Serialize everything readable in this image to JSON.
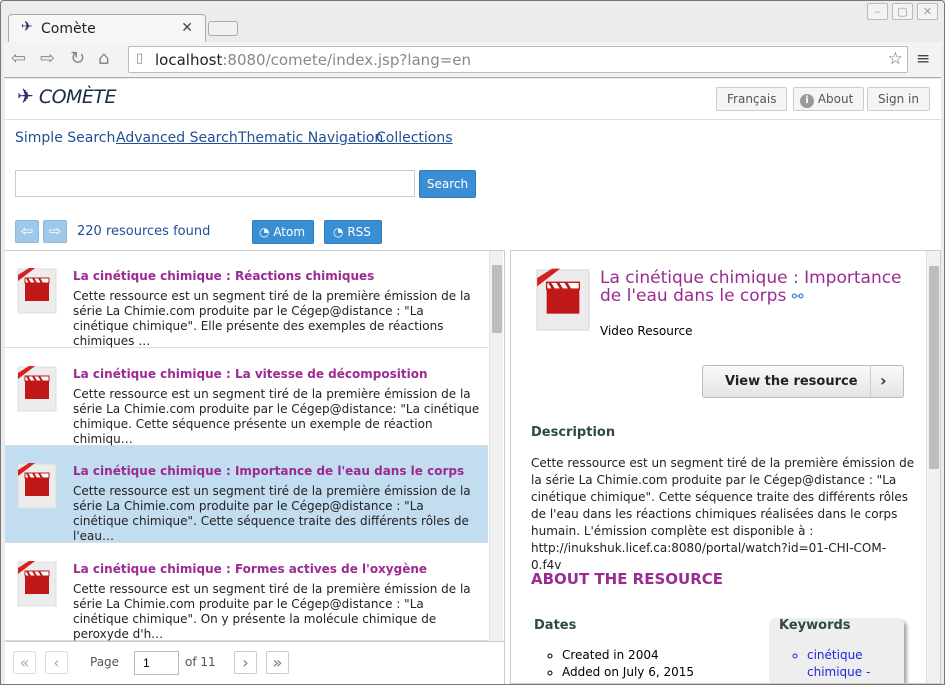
{
  "browser": {
    "tab_title": "Comète",
    "url_host": "localhost",
    "url_rest": ":8080/comete/index.jsp?lang=en"
  },
  "header": {
    "logo": "COMÈTE",
    "lang_button": "Français",
    "about_button": "About",
    "signin_button": "Sign in"
  },
  "nav": [
    "Simple Search",
    "Advanced Search",
    "Thematic Navigation",
    "Collections"
  ],
  "search": {
    "value": "",
    "placeholder": "",
    "button": "Search"
  },
  "results": {
    "count_text": "220 resources found",
    "atom": "Atom",
    "rss": "RSS"
  },
  "list": [
    {
      "title": "La cinétique chimique : Réactions chimiques",
      "desc": "Cette ressource est un segment tiré de la première émission de la série La Chimie.com produite par le Cégep@distance : \"La cinétique chimique\". Elle présente des exemples de réactions chimiques …",
      "selected": false
    },
    {
      "title": "La cinétique chimique : La vitesse de décomposition",
      "desc": "Cette ressource est un segment tiré de la première émission de la série La Chimie.com produite par le Cégep@distance: \"La cinétique chimique. Cette séquence présente un exemple de réaction chimiqu…",
      "selected": false
    },
    {
      "title": "La cinétique chimique : Importance de l'eau dans le corps",
      "desc": "Cette ressource est un segment tiré de la première émission de la série La Chimie.com produite par le Cégep@distance : \"La cinétique chimique\". Cette séquence traite des différents rôles de l'eau…",
      "selected": true
    },
    {
      "title": "La cinétique chimique : Formes actives de l'oxygène",
      "desc": "Cette ressource est un segment tiré de la première émission de la série La Chimie.com produite par le Cégep@distance : \"La cinétique chimique\". On y présente la molécule chimique de peroxyde d'h…",
      "selected": false
    }
  ],
  "pager": {
    "page_label": "Page",
    "page_value": "1",
    "of_label": "of 11"
  },
  "detail": {
    "title": "La cinétique chimique : Importance de l'eau dans le corps",
    "type": "Video Resource",
    "view_button": "View the resource",
    "description_heading": "Description",
    "description": "Cette ressource est un segment tiré de la première émission de la série La Chimie.com produite par le Cégep@distance : \"La cinétique chimique\". Cette séquence traite des différents rôles de l'eau dans les réactions chimiques réalisées dans le corps humain. L'émission complète est disponible à : http://inukshuk.licef.ca:8080/portal/watch?id=01-CHI-COM-0.f4v",
    "about_heading": "ABOUT THE RESOURCE",
    "dates_heading": "Dates",
    "dates": [
      "Created in 2004",
      "Added on July 6, 2015"
    ],
    "keywords_heading": "Keywords",
    "keywords": [
      "cinétique chimique -"
    ]
  },
  "colors": {
    "accent": "#3a8fd4",
    "title": "#9b2a93",
    "link": "#1f4f94",
    "selected_row": "#c2dcf0"
  }
}
